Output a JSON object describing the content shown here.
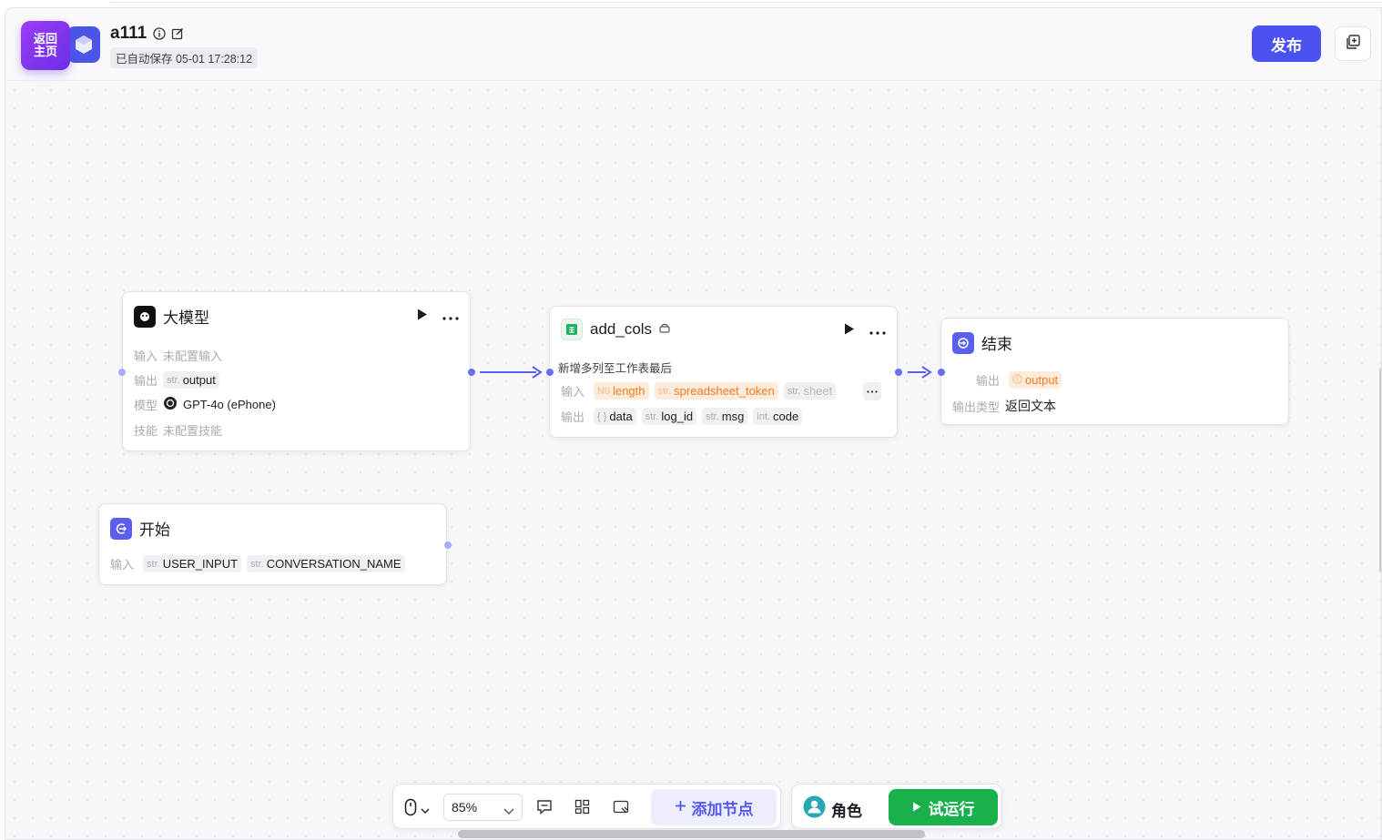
{
  "header": {
    "back_label": "返回\n主页",
    "app_title": "a111",
    "autosave": "已自动保存 05-01 17:28:12",
    "publish_label": "发布"
  },
  "nodes": {
    "llm": {
      "title": "大模型",
      "input_label": "输入",
      "input_value": "未配置输入",
      "output_label": "输出",
      "output_type": "str.",
      "output_value": "output",
      "model_label": "模型",
      "model_value": "GPT-4o (ePhone)",
      "skill_label": "技能",
      "skill_value": "未配置技能"
    },
    "add_cols": {
      "title": "add_cols",
      "description": "新增多列至工作表最后",
      "input_label": "输入",
      "inputs": [
        {
          "type": "N0",
          "name": "length"
        },
        {
          "type": "str.",
          "name": "spreadsheet_token"
        },
        {
          "type": "str.",
          "name": "sheet"
        }
      ],
      "output_label": "输出",
      "outputs": [
        {
          "type": "{ }",
          "name": "data"
        },
        {
          "type": "str.",
          "name": "log_id"
        },
        {
          "type": "str.",
          "name": "msg"
        },
        {
          "type": "int.",
          "name": "code"
        }
      ]
    },
    "end": {
      "title": "结束",
      "output_label": "输出",
      "output_value": "output",
      "output_type_label": "输出类型",
      "output_type_value": "返回文本"
    },
    "start": {
      "title": "开始",
      "input_label": "输入",
      "inputs": [
        {
          "type": "str.",
          "name": "USER_INPUT"
        },
        {
          "type": "str.",
          "name": "CONVERSATION_NAME"
        }
      ]
    }
  },
  "toolbar": {
    "zoom": "85%",
    "add_node_label": "添加节点",
    "role_label": "角色",
    "run_label": "试运行"
  },
  "colors": {
    "accent": "#4c52f2",
    "run": "#19b14b",
    "back_gradient": "#8b36f2",
    "warning": "#f07a1a"
  }
}
